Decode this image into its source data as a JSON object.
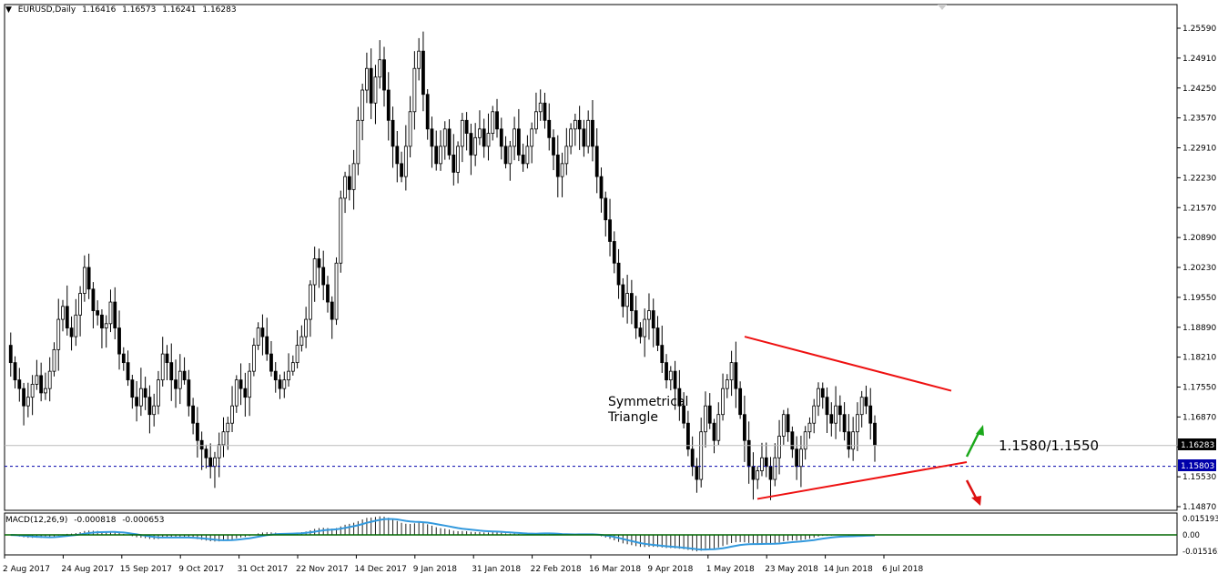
{
  "header": {
    "symbol_timeframe": "EURUSD,Daily",
    "open": "1.16416",
    "high": "1.16573",
    "low": "1.16241",
    "close": "1.16283"
  },
  "macd_header": {
    "name": "MACD(12,26,9)",
    "main": "-0.000818",
    "signal": "-0.000653"
  },
  "annotations": {
    "pattern_line1": "Symmetrical",
    "pattern_line2": "Triangle",
    "level_text": "1.1580/1.1550"
  },
  "price_labels": {
    "current": "1.16283",
    "support": "1.15803"
  },
  "colors": {
    "bullish_arrow": "#1aa81a",
    "bearish_arrow": "#dd1111",
    "trendline": "#ee1111",
    "candles": "#000000",
    "macd_line": "#3399dd",
    "zero_line": "#006600",
    "support_line": "#0000aa"
  },
  "chart_data": {
    "type": "candlestick",
    "symbol": "EURUSD",
    "timeframe": "Daily",
    "ylim": [
      1.1487,
      1.2593
    ],
    "y_ticks": [
      "1.25590",
      "1.24910",
      "1.24250",
      "1.23570",
      "1.22910",
      "1.22230",
      "1.21570",
      "1.20890",
      "1.20230",
      "1.19550",
      "1.18890",
      "1.18210",
      "1.17550",
      "1.16870",
      "1.16210",
      "1.15530",
      "1.14870"
    ],
    "x_ticks": [
      "2 Aug 2017",
      "24 Aug 2017",
      "15 Sep 2017",
      "9 Oct 2017",
      "31 Oct 2017",
      "22 Nov 2017",
      "14 Dec 2017",
      "9 Jan 2018",
      "31 Jan 2018",
      "22 Feb 2018",
      "16 Mar 2018",
      "9 Apr 2018",
      "1 May 2018",
      "23 May 2018",
      "14 Jun 2018",
      "6 Jul 2018"
    ],
    "close_path": [
      1.186,
      1.182,
      1.178,
      1.176,
      1.172,
      1.174,
      1.177,
      1.179,
      1.175,
      1.176,
      1.18,
      1.185,
      1.192,
      1.195,
      1.19,
      1.188,
      1.193,
      1.198,
      1.204,
      1.199,
      1.194,
      1.193,
      1.19,
      1.191,
      1.196,
      1.19,
      1.184,
      1.182,
      1.178,
      1.174,
      1.172,
      1.176,
      1.174,
      1.17,
      1.172,
      1.178,
      1.184,
      1.182,
      1.178,
      1.176,
      1.18,
      1.178,
      1.172,
      1.168,
      1.164,
      1.162,
      1.16,
      1.158,
      1.16,
      1.163,
      1.166,
      1.168,
      1.172,
      1.178,
      1.176,
      1.174,
      1.18,
      1.186,
      1.19,
      1.188,
      1.184,
      1.18,
      1.178,
      1.176,
      1.178,
      1.18,
      1.182,
      1.186,
      1.188,
      1.192,
      1.2,
      1.206,
      1.204,
      1.2,
      1.196,
      1.192,
      1.205,
      1.22,
      1.225,
      1.222,
      1.228,
      1.238,
      1.245,
      1.25,
      1.242,
      1.248,
      1.252,
      1.245,
      1.238,
      1.232,
      1.228,
      1.225,
      1.232,
      1.24,
      1.25,
      1.254,
      1.244,
      1.236,
      1.232,
      1.228,
      1.232,
      1.236,
      1.23,
      1.226,
      1.232,
      1.238,
      1.235,
      1.23,
      1.234,
      1.236,
      1.232,
      1.235,
      1.24,
      1.236,
      1.232,
      1.228,
      1.232,
      1.236,
      1.23,
      1.228,
      1.232,
      1.236,
      1.24,
      1.242,
      1.238,
      1.234,
      1.23,
      1.225,
      1.228,
      1.232,
      1.236,
      1.238,
      1.236,
      1.232,
      1.238,
      1.232,
      1.225,
      1.22,
      1.215,
      1.21,
      1.205,
      1.2,
      1.195,
      1.198,
      1.194,
      1.19,
      1.188,
      1.192,
      1.194,
      1.19,
      1.186,
      1.182,
      1.178,
      1.18,
      1.176,
      1.172,
      1.168,
      1.162,
      1.158,
      1.155,
      1.166,
      1.172,
      1.168,
      1.164,
      1.17,
      1.176,
      1.178,
      1.182,
      1.176,
      1.17,
      1.164,
      1.158,
      1.155,
      1.157,
      1.16,
      1.158,
      1.155,
      1.16,
      1.165,
      1.17,
      1.166,
      1.162,
      1.158,
      1.162,
      1.166,
      1.168,
      1.172,
      1.176,
      1.174,
      1.17,
      1.168,
      1.172,
      1.17,
      1.166,
      1.162,
      1.166,
      1.17,
      1.174,
      1.172,
      1.168,
      1.163
    ],
    "triangle": {
      "upper_trendline": [
        1.188,
        1.1755
      ],
      "lower_trendline": [
        1.1505,
        1.159
      ]
    },
    "support_level": 1.15803,
    "current_price": 1.16283,
    "pattern": "Symmetrical Triangle",
    "levels": [
      "1.1580",
      "1.1550"
    ],
    "macd": {
      "params": [
        12,
        26,
        9
      ],
      "main": -0.000818,
      "signal": -0.000653,
      "ylim": [
        -0.01516,
        0.01519
      ],
      "y_ticks": [
        "0.015193",
        "0.00",
        "-0.015162"
      ]
    }
  }
}
